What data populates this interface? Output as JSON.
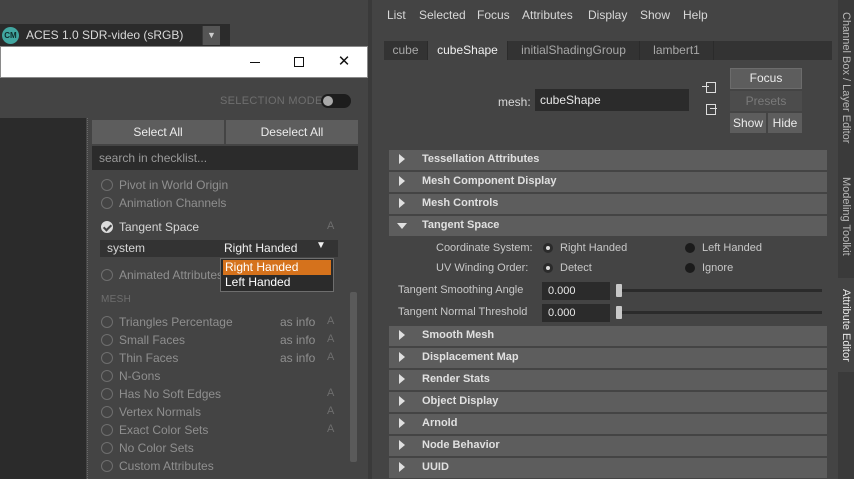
{
  "color_management": {
    "icon": "color-management-icon",
    "icon_text": "CM",
    "color_space": "ACES 1.0 SDR-video (sRGB)"
  },
  "window": {
    "minimize_icon": "minimize-icon",
    "maximize_icon": "maximize-icon",
    "close_icon": "close-icon",
    "close_glyph": "✕"
  },
  "checklist_panel": {
    "selection_mode_label": "SELECTION MODE",
    "selection_mode_on": false,
    "select_all": "Select All",
    "deselect_all": "Deselect All",
    "search_placeholder": "search in checklist...",
    "items_top": [
      {
        "label": "Pivot in World Origin",
        "checked": false,
        "a": ""
      },
      {
        "label": "Animation Channels",
        "checked": false,
        "a": ""
      },
      {
        "label": "Tangent Space",
        "checked": true,
        "a": "A"
      }
    ],
    "system": {
      "label": "system",
      "value": "Right Handed",
      "options": [
        "Right Handed",
        "Left Handed"
      ],
      "highlighted": "Right Handed"
    },
    "animated_attributes": "Animated Attributes",
    "mesh_heading": "MESH",
    "mesh_items": [
      {
        "label": "Triangles Percentage",
        "info": "as info",
        "a": "A"
      },
      {
        "label": "Small Faces",
        "info": "as info",
        "a": "A"
      },
      {
        "label": "Thin Faces",
        "info": "as info",
        "a": "A"
      },
      {
        "label": "N-Gons",
        "info": "",
        "a": ""
      },
      {
        "label": "Has No Soft Edges",
        "info": "",
        "a": "A"
      },
      {
        "label": "Vertex Normals",
        "info": "",
        "a": "A"
      },
      {
        "label": "Exact Color Sets",
        "info": "",
        "a": "A"
      },
      {
        "label": "No Color Sets",
        "info": "",
        "a": ""
      },
      {
        "label": "Custom Attributes",
        "info": "",
        "a": ""
      }
    ]
  },
  "attribute_editor": {
    "menu": [
      "List",
      "Selected",
      "Focus",
      "Attributes",
      "Display",
      "Show",
      "Help"
    ],
    "tabs": [
      "cube",
      "cubeShape",
      "initialShadingGroup",
      "lambert1"
    ],
    "active_tab": "cubeShape",
    "mesh_label": "mesh:",
    "mesh_value": "cubeShape",
    "focus": "Focus",
    "presets": "Presets",
    "show": "Show",
    "hide": "Hide",
    "sections_before": [
      "Tessellation Attributes",
      "Mesh Component Display",
      "Mesh Controls"
    ],
    "open_section": "Tangent Space",
    "tangent_space": {
      "coordinate_system_label": "Coordinate System:",
      "coordinate_options": [
        "Right Handed",
        "Left Handed"
      ],
      "coordinate_selected": "Right Handed",
      "uv_winding_label": "UV Winding Order:",
      "uv_options": [
        "Detect",
        "Ignore"
      ],
      "uv_selected": "Detect",
      "smoothing_angle_label": "Tangent Smoothing Angle",
      "smoothing_angle_value": "0.000",
      "normal_threshold_label": "Tangent Normal Threshold",
      "normal_threshold_value": "0.000"
    },
    "sections_after": [
      "Smooth Mesh",
      "Displacement Map",
      "Render Stats",
      "Object Display",
      "Arnold",
      "Node Behavior",
      "UUID"
    ]
  },
  "side_tabs": [
    "Channel Box / Layer Editor",
    "Modeling Toolkit",
    "Attribute Editor"
  ],
  "active_side_tab": "Attribute Editor",
  "colors": {
    "highlight": "#d5721c",
    "panel_bg": "#444444",
    "field_bg": "#2b2b2b",
    "section_bg": "#5d5d5d"
  }
}
